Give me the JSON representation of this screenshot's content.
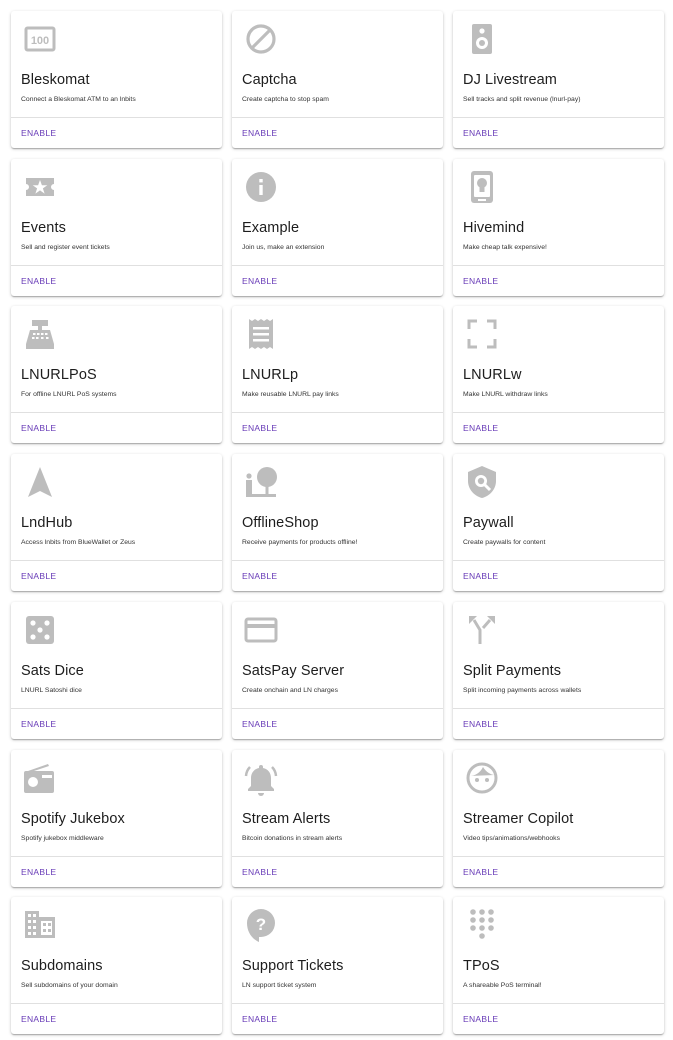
{
  "colors": {
    "accent": "#673ab7",
    "icon": "#bdbdbd",
    "divider": "#e0e0e0"
  },
  "extensions": [
    {
      "title": "Bleskomat",
      "description": "Connect a Bleskomat ATM to an lnbits",
      "action": "ENABLE",
      "icon": "atm-icon"
    },
    {
      "title": "Captcha",
      "description": "Create captcha to stop spam",
      "action": "ENABLE",
      "icon": "block-icon"
    },
    {
      "title": "DJ Livestream",
      "description": "Sell tracks and split revenue (lnurl-pay)",
      "action": "ENABLE",
      "icon": "speaker-icon"
    },
    {
      "title": "Events",
      "description": "Sell and register event tickets",
      "action": "ENABLE",
      "icon": "ticket-icon"
    },
    {
      "title": "Example",
      "description": "Join us, make an extension",
      "action": "ENABLE",
      "icon": "info-icon"
    },
    {
      "title": "Hivemind",
      "description": "Make cheap talk expensive!",
      "action": "ENABLE",
      "icon": "lightbulb-icon"
    },
    {
      "title": "LNURLPoS",
      "description": "For offline LNURL PoS systems",
      "action": "ENABLE",
      "icon": "cash-register-icon"
    },
    {
      "title": "LNURLp",
      "description": "Make reusable LNURL pay links",
      "action": "ENABLE",
      "icon": "receipt-icon"
    },
    {
      "title": "LNURLw",
      "description": "Make LNURL withdraw links",
      "action": "ENABLE",
      "icon": "crop-free-icon"
    },
    {
      "title": "LndHub",
      "description": "Access lnbits from BlueWallet or Zeus",
      "action": "ENABLE",
      "icon": "navigation-icon"
    },
    {
      "title": "OfflineShop",
      "description": "Receive payments for products offline!",
      "action": "ENABLE",
      "icon": "nature-people-icon"
    },
    {
      "title": "Paywall",
      "description": "Create paywalls for content",
      "action": "ENABLE",
      "icon": "policy-icon"
    },
    {
      "title": "Sats Dice",
      "description": "LNURL Satoshi dice",
      "action": "ENABLE",
      "icon": "dice-icon"
    },
    {
      "title": "SatsPay Server",
      "description": "Create onchain and LN charges",
      "action": "ENABLE",
      "icon": "credit-card-icon"
    },
    {
      "title": "Split Payments",
      "description": "Split incoming payments across wallets",
      "action": "ENABLE",
      "icon": "call-split-icon"
    },
    {
      "title": "Spotify Jukebox",
      "description": "Spotify jukebox middleware",
      "action": "ENABLE",
      "icon": "radio-icon"
    },
    {
      "title": "Stream Alerts",
      "description": "Bitcoin donations in stream alerts",
      "action": "ENABLE",
      "icon": "notifications-active-icon"
    },
    {
      "title": "Streamer Copilot",
      "description": "Video tips/animations/webhooks",
      "action": "ENABLE",
      "icon": "face-icon"
    },
    {
      "title": "Subdomains",
      "description": "Sell subdomains of your domain",
      "action": "ENABLE",
      "icon": "domain-icon"
    },
    {
      "title": "Support Tickets",
      "description": "LN support ticket system",
      "action": "ENABLE",
      "icon": "contact-support-icon"
    },
    {
      "title": "TPoS",
      "description": "A shareable PoS terminal!",
      "action": "ENABLE",
      "icon": "dialpad-icon"
    }
  ]
}
